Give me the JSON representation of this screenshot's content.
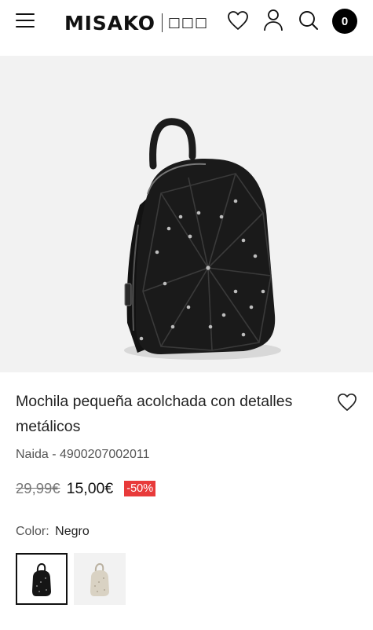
{
  "header": {
    "logo_text": "MISAKO",
    "logo_sub": "□□□",
    "cart_count": "0",
    "icons": [
      "menu-icon",
      "heart-icon",
      "user-icon",
      "search-icon"
    ]
  },
  "product": {
    "image_alt": "Mochila pequeña acolchada negra",
    "title": "Mochila pequeña acolchada con detalles metálicos",
    "reference": "Naida - 4900207002011",
    "old_price": "29,99€",
    "new_price": "15,00€",
    "discount": "-50%",
    "color_label": "Color:",
    "color_value": "Negro",
    "swatches": [
      {
        "color": "Negro",
        "hex": "#111111",
        "selected": true
      },
      {
        "color": "Beige",
        "hex": "#d9d2c3",
        "selected": false
      }
    ]
  },
  "colors": {
    "discount_bg": "#e83a3a",
    "image_bg": "#f2f2f2"
  }
}
